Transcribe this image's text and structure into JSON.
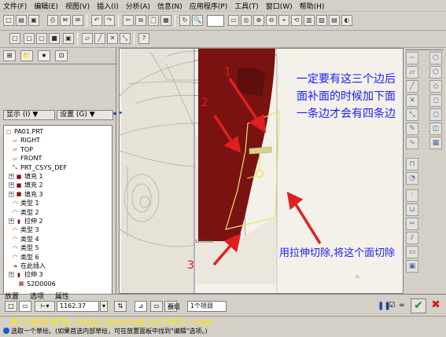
{
  "menu": [
    "文件(F)",
    "编辑(E)",
    "视图(V)",
    "插入(I)",
    "分析(A)",
    "信息(N)",
    "应用程序(P)",
    "工具(T)",
    "窗口(W)",
    "帮助(H)"
  ],
  "left_panel": {
    "display_label": "显示 (I) ▼",
    "settings_label": "设置 (G) ▼"
  },
  "tree": {
    "items": [
      {
        "label": "PA01.PRT",
        "icon": "part-icon"
      },
      {
        "label": "RIGHT",
        "icon": "datum-plane-icon"
      },
      {
        "label": "TOP",
        "icon": "datum-plane-icon"
      },
      {
        "label": "FRONT",
        "icon": "datum-plane-icon"
      },
      {
        "label": "PRT_CSYS_DEF",
        "icon": "csys-icon"
      },
      {
        "label": "填充 1",
        "icon": "fill-icon"
      },
      {
        "label": "填充 2",
        "icon": "fill-icon"
      },
      {
        "label": "填充 3",
        "icon": "fill-icon"
      },
      {
        "label": "类型 1",
        "icon": "style-icon"
      },
      {
        "label": "类型 2",
        "icon": "style-icon"
      },
      {
        "label": "拉伸 2",
        "icon": "extrude-icon"
      },
      {
        "label": "类型 3",
        "icon": "style-icon"
      },
      {
        "label": "类型 4",
        "icon": "style-icon"
      },
      {
        "label": "类型 5",
        "icon": "style-icon"
      },
      {
        "label": "类型 6",
        "icon": "style-icon"
      },
      {
        "label": "在此插入",
        "icon": "insert-arrow-icon"
      },
      {
        "label": "拉伸 3",
        "icon": "extrude-icon"
      },
      {
        "label": "S2D0006",
        "icon": "sketch-icon"
      }
    ]
  },
  "annotations": {
    "top_text": "一定要有这三个边后面补面的时候加下面一条边才会有四条边",
    "bottom_text": "用拉伸切除,将这个面切除",
    "numbers": [
      "1",
      "2",
      "3"
    ]
  },
  "dashboard": {
    "tabs": [
      "放置",
      "选项",
      "属性"
    ],
    "depth_value": "1162.37",
    "face_group_label": "面组",
    "face_group_value": "1个项目"
  },
  "status": {
    "watermark": "天下设计论坛: http://procad.uu1001.com",
    "message": "选取一个草绘。(如果首选内部草绘，可在放置面板中找到\"编辑\"选项。)"
  },
  "colors": {
    "annotation_blue": "#1a1aff",
    "arrow_red": "#e02020",
    "surface_red": "#7a1212",
    "watermark_yellow": "#ffe400",
    "sketch_yellow": "#f0e060"
  }
}
